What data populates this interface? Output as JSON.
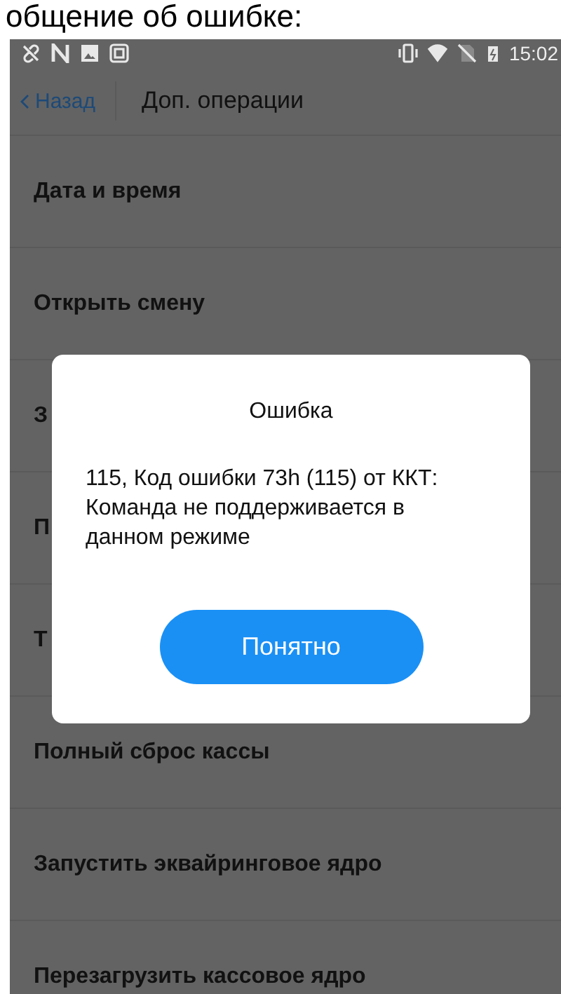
{
  "caption": "общение об ошибке:",
  "status_bar": {
    "time": "15:02"
  },
  "header": {
    "back": "Назад",
    "title": "Доп. операции"
  },
  "items": [
    {
      "label": "Дата и время"
    },
    {
      "label": "Открыть смену"
    },
    {
      "label": "З"
    },
    {
      "label": "П"
    },
    {
      "label": "Т"
    },
    {
      "label": "Полный сброс кассы"
    },
    {
      "label": "Запустить эквайринговое ядро"
    },
    {
      "label": "Перезагрузить кассовое ядро"
    }
  ],
  "dialog": {
    "title": "Ошибка",
    "message": "115, Код ошибки 73h (115) от ККТ: Команда не поддерживается в данном режиме",
    "button": "Понятно"
  }
}
